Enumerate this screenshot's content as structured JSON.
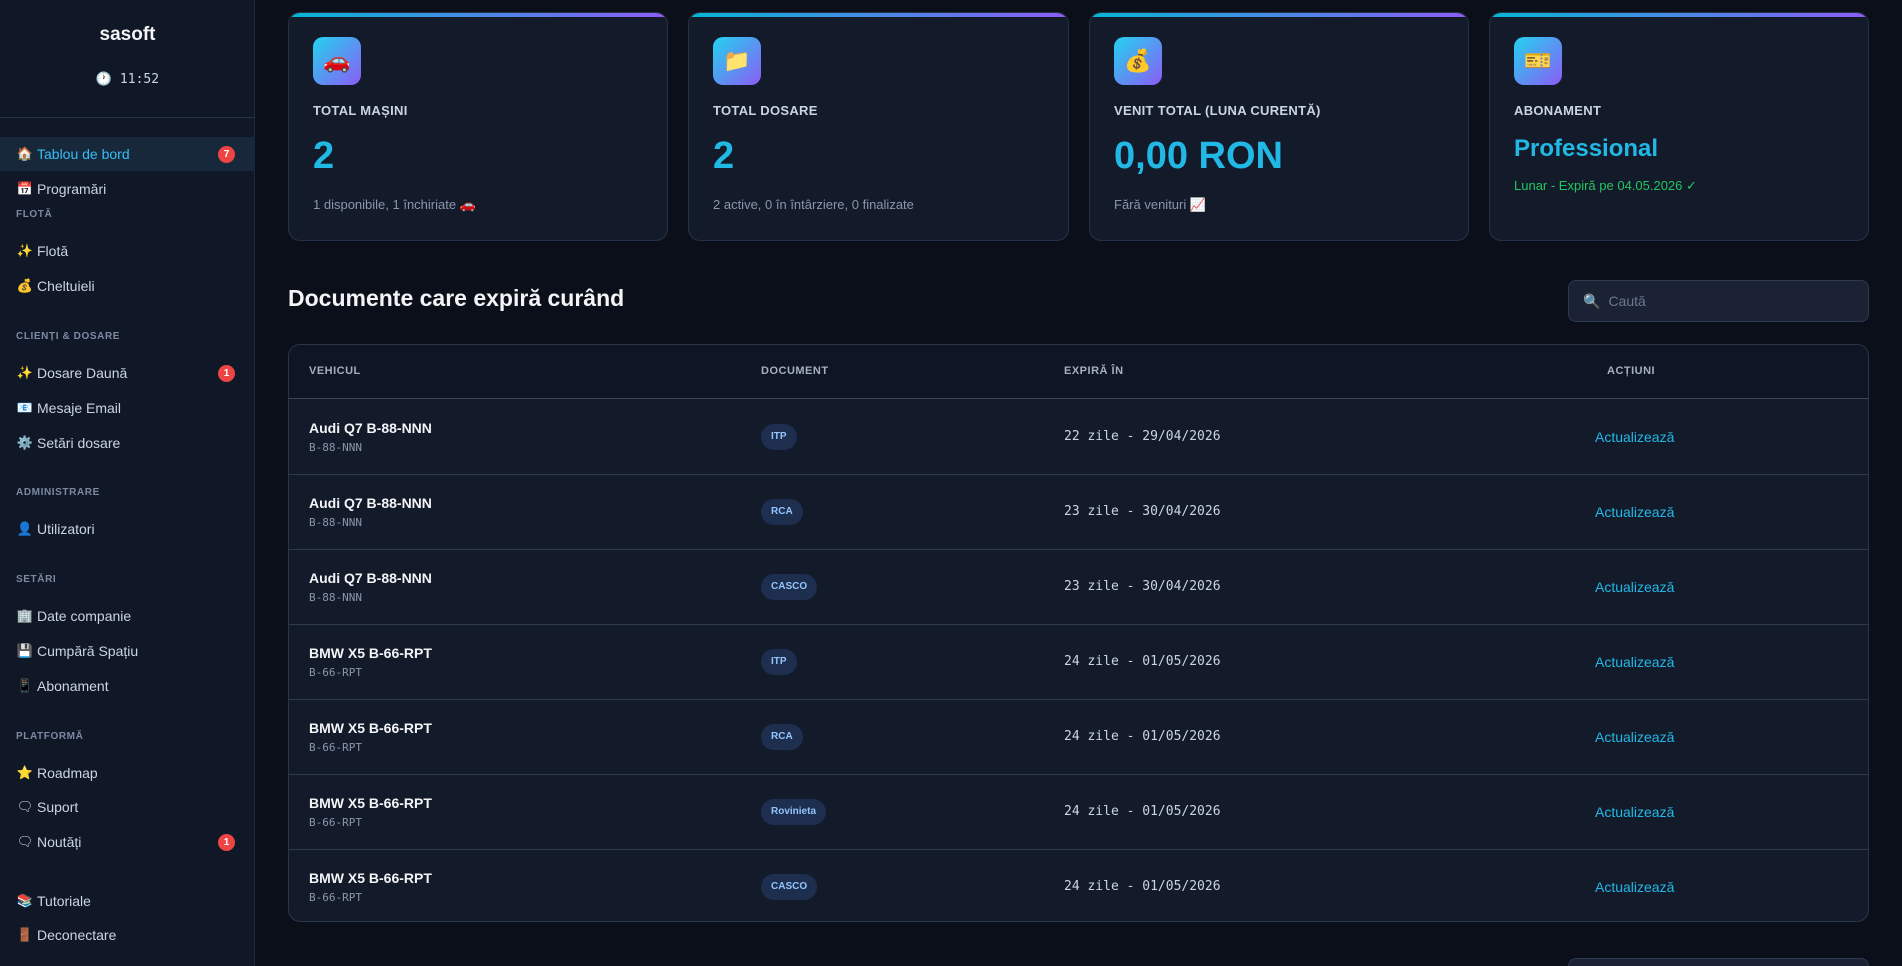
{
  "sidebar": {
    "brand": "sasoft",
    "clock": "🕐 11:52",
    "items": {
      "dashboard": {
        "icon": "🏠",
        "label": "Tablou de bord",
        "badge": "7"
      },
      "appointments": {
        "icon": "📅",
        "label": "Programări"
      },
      "fleet": {
        "icon": "✨",
        "label": "Flotă"
      },
      "expenses": {
        "icon": "💰",
        "label": "Cheltuieli"
      },
      "claims": {
        "icon": "✨",
        "label": "Dosare Daună",
        "badge": "1"
      },
      "email": {
        "icon": "📧",
        "label": "Mesaje Email"
      },
      "claim_settings": {
        "icon": "⚙️",
        "label": "Setări dosare"
      },
      "users": {
        "icon": "👤",
        "label": "Utilizatori"
      },
      "company": {
        "icon": "🏢",
        "label": "Date companie"
      },
      "storage": {
        "icon": "💾",
        "label": "Cumpără Spațiu"
      },
      "subscription": {
        "icon": "📱",
        "label": "Abonament"
      },
      "roadmap": {
        "icon": "⭐",
        "label": "Roadmap"
      },
      "support": {
        "icon": "🗨",
        "label": "Suport"
      },
      "news": {
        "icon": "🗨",
        "label": "Noutăți",
        "badge": "1"
      },
      "tutorials": {
        "icon": "📚",
        "label": "Tutoriale"
      },
      "logout": {
        "icon": "🚪",
        "label": "Deconectare"
      }
    },
    "sections": {
      "fleet": "FLOTĂ",
      "clients": "CLIENȚI & DOSARE",
      "admin": "ADMINISTRARE",
      "settings": "SETĂRI",
      "platform": "PLATFORMĂ"
    }
  },
  "cards": {
    "cars": {
      "icon": "🚗",
      "label": "TOTAL MAȘINI",
      "value": "2",
      "sub": "1 disponibile, 1 închiriate 🚗"
    },
    "files": {
      "icon": "📁",
      "label": "TOTAL DOSARE",
      "value": "2",
      "sub": "2 active, 0 în întârziere, 0 finalizate"
    },
    "revenue": {
      "icon": "💰",
      "label": "VENIT TOTAL (LUNA CURENTĂ)",
      "value": "0,00 RON",
      "sub": "Fără venituri 📈"
    },
    "subscription": {
      "icon": "🎫",
      "label": "ABONAMENT",
      "value": "Professional",
      "sub": "Lunar - Expiră pe 04.05.2026 ✓"
    }
  },
  "expiring": {
    "title": "Documente care expiră curând",
    "search_placeholder": "Caută",
    "columns": {
      "vehicle": "VEHICUL",
      "document": "DOCUMENT",
      "expires": "EXPIRĂ ÎN",
      "actions": "ACȚIUNI"
    },
    "rows": [
      {
        "vehicle": "Audi Q7 B-88-NNN",
        "plate": "B-88-NNN",
        "document": "ITP",
        "expires": "22 zile - 29/04/2026",
        "action": "Actualizează"
      },
      {
        "vehicle": "Audi Q7 B-88-NNN",
        "plate": "B-88-NNN",
        "document": "RCA",
        "expires": "23 zile - 30/04/2026",
        "action": "Actualizează"
      },
      {
        "vehicle": "Audi Q7 B-88-NNN",
        "plate": "B-88-NNN",
        "document": "CASCO",
        "expires": "23 zile - 30/04/2026",
        "action": "Actualizează"
      },
      {
        "vehicle": "BMW X5 B-66-RPT",
        "plate": "B-66-RPT",
        "document": "ITP",
        "expires": "24 zile - 01/05/2026",
        "action": "Actualizează"
      },
      {
        "vehicle": "BMW X5 B-66-RPT",
        "plate": "B-66-RPT",
        "document": "RCA",
        "expires": "24 zile - 01/05/2026",
        "action": "Actualizează"
      },
      {
        "vehicle": "BMW X5 B-66-RPT",
        "plate": "B-66-RPT",
        "document": "Rovinieta",
        "expires": "24 zile - 01/05/2026",
        "action": "Actualizează"
      },
      {
        "vehicle": "BMW X5 B-66-RPT",
        "plate": "B-66-RPT",
        "document": "CASCO",
        "expires": "24 zile - 01/05/2026",
        "action": "Actualizează"
      }
    ]
  }
}
